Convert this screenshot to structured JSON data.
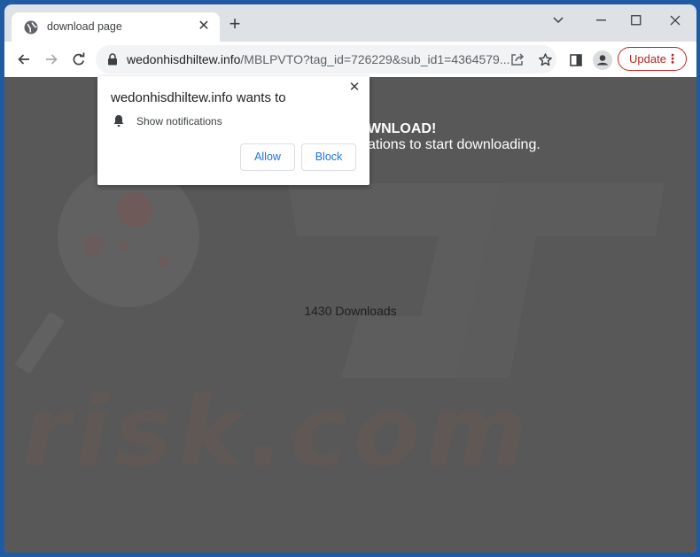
{
  "tab": {
    "title": "download page",
    "favicon": "globe-icon",
    "close_icon": "close-icon",
    "new_tab_icon": "plus-icon"
  },
  "window_controls": {
    "tab_search": "chevron-down-icon",
    "minimize": "minimize-icon",
    "maximize": "maximize-icon",
    "close": "close-icon"
  },
  "toolbar": {
    "back": "arrow-left-icon",
    "forward": "arrow-right-icon",
    "reload": "reload-icon",
    "url_host": "wedonhisdhiltew.info",
    "url_path": "/MBLPVTO?tag_id=726229&sub_id1=4364579...",
    "update_label": "Update",
    "update_menu": "⋮",
    "colors": {
      "update_border": "#c5221f",
      "update_text": "#b3261e"
    }
  },
  "page": {
    "headline_fragment": "WNLOAD!",
    "subtext_fragment": "ations to start downloading.",
    "downloads": "1430 Downloads",
    "background": "#585858"
  },
  "popup": {
    "title": "wedonhisdhiltew.info wants to",
    "permission_icon": "bell-icon",
    "permission": "Show notifications",
    "allow_label": "Allow",
    "block_label": "Block",
    "accent": "#1a73e8"
  }
}
